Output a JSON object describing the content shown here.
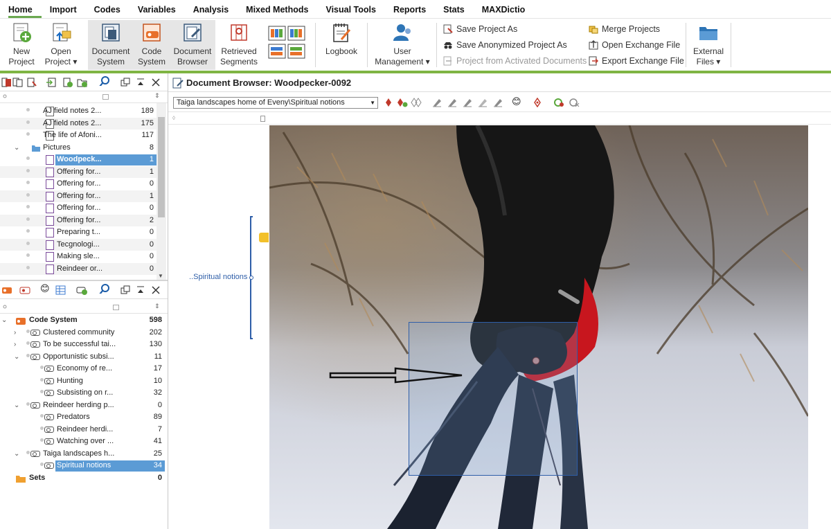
{
  "menu": [
    "Home",
    "Import",
    "Codes",
    "Variables",
    "Analysis",
    "Mixed Methods",
    "Visual Tools",
    "Reports",
    "Stats",
    "MAXDictio"
  ],
  "ribbon": {
    "new_project": [
      "New",
      "Project"
    ],
    "open_project": [
      "Open",
      "Project ▾"
    ],
    "document_system": [
      "Document",
      "System"
    ],
    "code_system": [
      "Code",
      "System"
    ],
    "document_browser": [
      "Document",
      "Browser"
    ],
    "retrieved_segments": [
      "Retrieved",
      "Segments"
    ],
    "logbook": "Logbook",
    "user_management": [
      "User",
      "Management ▾"
    ],
    "save_project_as": "Save Project As",
    "save_anonymized": "Save Anonymized Project As",
    "project_from_activated": "Project from Activated Documents",
    "merge_projects": "Merge Projects",
    "open_exchange": "Open Exchange File",
    "export_exchange": "Export Exchange File",
    "external_files": [
      "External",
      "Files ▾"
    ]
  },
  "document_tree": [
    {
      "label": "AJ field notes 2...",
      "count": "189",
      "icon": "document-icon",
      "indent": 1
    },
    {
      "label": "AJ field notes 2...",
      "count": "175",
      "icon": "document-icon",
      "indent": 1
    },
    {
      "label": "The life of Afoni...",
      "count": "117",
      "icon": "document-icon",
      "indent": 1
    },
    {
      "label": "Pictures",
      "count": "8",
      "icon": "folder-icon",
      "indent": 0,
      "expanded": true
    },
    {
      "label": "Woodpeck...",
      "count": "1",
      "icon": "image-icon",
      "indent": 1,
      "selected": true
    },
    {
      "label": "Offering for...",
      "count": "1",
      "icon": "image-icon",
      "indent": 1
    },
    {
      "label": "Offering for...",
      "count": "0",
      "icon": "image-icon",
      "indent": 1
    },
    {
      "label": "Offering for...",
      "count": "1",
      "icon": "image-icon",
      "indent": 1
    },
    {
      "label": "Offering for...",
      "count": "0",
      "icon": "image-icon",
      "indent": 1
    },
    {
      "label": "Offering for...",
      "count": "2",
      "icon": "image-icon",
      "indent": 1
    },
    {
      "label": "Preparing t...",
      "count": "0",
      "icon": "image-icon",
      "indent": 1
    },
    {
      "label": "Tecgnologi...",
      "count": "0",
      "icon": "image-icon",
      "indent": 1
    },
    {
      "label": "Making sle...",
      "count": "0",
      "icon": "image-icon",
      "indent": 1
    },
    {
      "label": "Reindeer or...",
      "count": "0",
      "icon": "image-icon",
      "indent": 1
    }
  ],
  "code_tree": [
    {
      "label": "Code System",
      "count": "598",
      "level": 0,
      "root": true,
      "expanded": true
    },
    {
      "label": "Clustered community",
      "count": "202",
      "level": 1,
      "collapsed": true
    },
    {
      "label": "To be successful tai...",
      "count": "130",
      "level": 1,
      "collapsed": true
    },
    {
      "label": "Opportunistic subsi...",
      "count": "11",
      "level": 1,
      "expanded": true
    },
    {
      "label": "Economy of re...",
      "count": "17",
      "level": 2
    },
    {
      "label": "Hunting",
      "count": "10",
      "level": 2
    },
    {
      "label": "Subsisting on r...",
      "count": "32",
      "level": 2
    },
    {
      "label": "Reindeer herding p...",
      "count": "0",
      "level": 1,
      "expanded": true
    },
    {
      "label": "Predators",
      "count": "89",
      "level": 2
    },
    {
      "label": "Reindeer herdi...",
      "count": "7",
      "level": 2
    },
    {
      "label": "Watching over ...",
      "count": "41",
      "level": 2
    },
    {
      "label": "Taiga landscapes h...",
      "count": "25",
      "level": 1,
      "expanded": true
    },
    {
      "label": "Spiritual notions",
      "count": "34",
      "level": 2,
      "selected": true
    },
    {
      "label": "Sets",
      "count": "0",
      "level": 0,
      "root": true,
      "sets": true
    }
  ],
  "browser": {
    "title": "Document Browser: Woodpecker-0092",
    "code_select": "Taiga landscapes home of Eveny\\Spiritual notions",
    "margin_code": "..Spiritual notions"
  }
}
